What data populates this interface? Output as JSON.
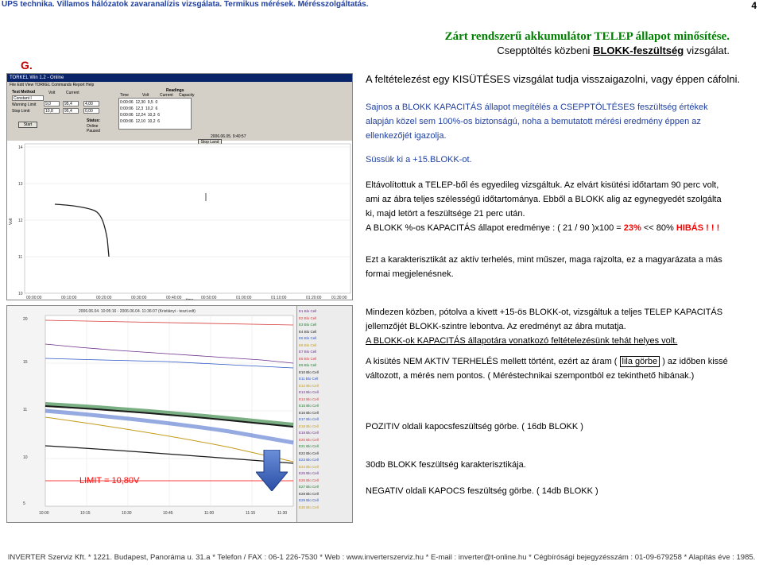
{
  "header": {
    "title": "UPS technika. Villamos hálózatok zavaranalízis vizsgálata. Termikus mérések. Mérésszolgáltatás.",
    "page_number": "4",
    "section_letter": "G."
  },
  "title": {
    "line1": "Zárt rendszerű akkumulátor TELEP állapot minősítése.",
    "line2_pre": "Csepptöltés közbeni ",
    "line2_bold": "BLOKK-feszültség",
    "line2_post": " vizsgálat."
  },
  "hypothesis": "A feltételezést egy KISÜTÉSES vizsgálat tudja visszaigazolni, vagy éppen cáfolni.",
  "blocks": {
    "p1": "Sajnos a BLOKK KAPACITÁS állapot megítélés a CSEPPTÖLTÉSES feszültség értékek alapján közel sem 100%-os biztonságú, noha a bemutatott mérési eredmény éppen az ellenkezőjét igazolja.",
    "p2": "Süssük ki a +15.BLOKK-ot.",
    "p3a": "Eltávolítottuk a TELEP-ből és egyedileg vizsgáltuk. Az elvárt kisütési időtartam 90 perc volt, ami az ábra teljes szélességű időtartománya. Ebből a BLOKK alig az egynegyedét szolgálta ki, majd letört a feszültsége 21 perc után.",
    "p3b_pre": "A BLOKK %-os KAPACITÁS állapot eredménye : ( 21 / 90 )x100 = ",
    "p3b_val": "23%",
    "p3b_mid": " << 80%  ",
    "p3b_bad": "HIBÁS ! ! !",
    "p4": "Ezt a karakterisztikát az aktív terhelés, mint műszer, maga rajzolta, ez a magyarázata a más formai megjelenésnek.",
    "p5a": "Mindezen közben, pótolva a kivett +15-ös BLOKK-ot, vizsgáltuk a teljes TELEP KAPACITÁS jellemzőjét BLOKK-szintre lebontva. Az eredményt az ábra mutatja.",
    "p5b": "A BLOKK-ok KAPACITÁS állapotára vonatkozó feltételezésünk tehát helyes volt.",
    "p6_pre": "A kisütés NEM AKTIV TERHELÉS mellett történt, ezért az áram ( ",
    "p6_box": "lila görbe",
    "p6_post": " ) az időben kissé változott, a mérés nem pontos. ( Méréstechnikai szempontból ez tekinthető hibának.)",
    "p7": "POZITIV oldali kapocsfeszültség görbe. ( 16db BLOKK )",
    "p8": "30db BLOKK feszültség karakterisztikája.",
    "p9": "NEGATIV oldali KAPOCS feszültség görbe. ( 14db BLOKK )"
  },
  "screenshot1": {
    "window_title": "TORKEL Win 1.2 - Online",
    "menu": "File  Edit  View  TORKEL Commands  Report  Help",
    "test_method_label": "Test Method",
    "test_method_value": "Constant I",
    "cols": [
      "Volt",
      "Current"
    ],
    "row_labels": [
      "Warning Limit",
      "Stop Limit"
    ],
    "row_values": [
      [
        "9,0",
        "95,4",
        "4,00"
      ],
      [
        "10,8",
        "95,4",
        "0,00"
      ]
    ],
    "start_button": "Start",
    "stop_button": "Stop Land",
    "readings_title": "Readings",
    "readings_headers": [
      "Time",
      "Volt",
      "Current",
      "Capacity"
    ],
    "readings_rows": [
      [
        "0:00:06",
        "12,30",
        "9,5",
        "0"
      ],
      [
        "0:00:06",
        "12,3",
        "10,2",
        "6"
      ],
      [
        "0:00:06",
        "12,24",
        "10,3",
        "6"
      ],
      [
        "0:00:06",
        "12,10",
        "10,2",
        "6"
      ]
    ],
    "status_label": "Status:",
    "status_values": [
      "Online",
      "Paused"
    ],
    "y_ticks": [
      "14",
      "13",
      "12",
      "11",
      "10"
    ],
    "x_ticks": [
      "00:00:00",
      "00:10:00",
      "00:20:00",
      "00:30:00",
      "00:40:00",
      "00:50:00",
      "01:00:00",
      "01:10:00",
      "01:20:00",
      "01:30:00"
    ],
    "x_label": "time",
    "y_label": "Volt",
    "marker_text": "2006.06.05. 9:40:57"
  },
  "screenshot2": {
    "y_ticks": [
      "20",
      "15",
      "11",
      "10",
      "5"
    ],
    "x_ticks": [
      "10:00",
      "10:15",
      "10:30",
      "10:45",
      "11:00",
      "11:15",
      "11:30"
    ],
    "top_label": "2006.06.04. 10:05:16 - 2006.06.04. 11:36:07 (Kristiányi - teszt.edt)",
    "legend": [
      "E1 Blo Cell",
      "E2 Blo Cell",
      "E3 Blo Cell",
      "E4 Blo Cell",
      "E5 Blo Cell",
      "E6 Blo Cell",
      "E7 Blo Cell",
      "E8 Blo Cell",
      "E9 Blo Cell",
      "E10 Blo Cell",
      "E11 Blo Cell",
      "E12 Blo Cell",
      "E13 Blo Cell",
      "E14 Blo Cell",
      "E15 Blo Cell",
      "E16 Blo Cell",
      "E17 Blo Cell",
      "E18 Blo Cell",
      "E19 Blo Cell",
      "E20 Blo Cell",
      "E21 Blo Cell",
      "E22 Blo Cell",
      "E23 Blo Cell",
      "E24 Blo Cell",
      "E25 Blo Cell",
      "E26 Blo Cell",
      "E27 Blo Cell",
      "E28 Blo Cell",
      "E29 Blo Cell",
      "E30 Blo Cell"
    ],
    "colors": [
      "#6b2d8a",
      "#d63a3a",
      "#1f7a2e",
      "#1a1a1a",
      "#2b55c4",
      "#c49a1a"
    ]
  },
  "limit_label": "LIMIT = 10,80V",
  "footer": "INVERTER Szerviz Kft. * 1221. Budapest, Panoráma u. 31.a * Telefon / FAX : 06-1 226-7530 * Web : www.inverterszerviz.hu * E-mail : inverter@t-online.hu * Cégbírósági bejegyzésszám : 01-09-679258 * Alapítás éve : 1985."
}
